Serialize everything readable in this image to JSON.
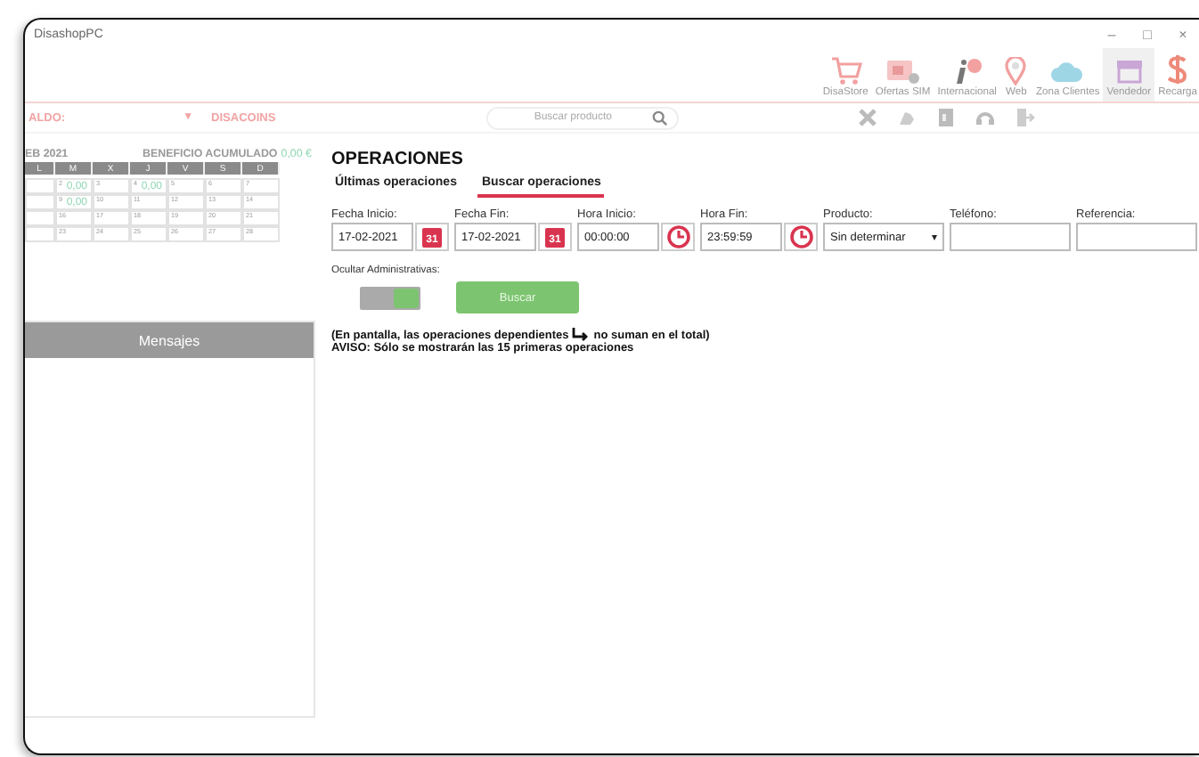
{
  "window": {
    "title": "DisashopPC",
    "controls": [
      "–",
      "□",
      "×"
    ]
  },
  "toolbar": [
    {
      "label": "DisaStore",
      "kind": "cart",
      "selected": false
    },
    {
      "label": "Ofertas SIM",
      "kind": "sim",
      "selected": false
    },
    {
      "label": "Internacional",
      "kind": "info",
      "selected": false
    },
    {
      "label": "Web",
      "kind": "pin",
      "selected": false
    },
    {
      "label": "Zona Clientes",
      "kind": "cloud",
      "selected": false
    },
    {
      "label": "Vendedor",
      "kind": "shop",
      "selected": true
    },
    {
      "label": "Recarga",
      "kind": "dollar",
      "selected": false
    }
  ],
  "balance_bar": {
    "balance_label": "ALDO:",
    "caret": "▼",
    "coins_label": "DISACOINS",
    "search": {
      "placeholder": "Buscar producto"
    }
  },
  "calendar": {
    "month": "EB 2021",
    "benefit_label": "BENEFICIO ACUMULADO",
    "benefit_value": "0,00 €",
    "weekdays": [
      "L",
      "M",
      "X",
      "J",
      "V",
      "S",
      "D"
    ],
    "weeks": [
      {
        "days": [
          {
            "day": "2",
            "amount": "0,00"
          },
          {
            "day": "3"
          },
          {
            "day": "4",
            "amount": "0,00"
          },
          {
            "day": "5"
          },
          {
            "day": "6"
          },
          {
            "day": "7"
          }
        ]
      },
      {
        "days": [
          {
            "day": "9",
            "amount": "0,00"
          },
          {
            "day": "10"
          },
          {
            "day": "11"
          },
          {
            "day": "12"
          },
          {
            "day": "13"
          },
          {
            "day": "14"
          }
        ]
      },
      {
        "days": [
          {
            "day": "16"
          },
          {
            "day": "17"
          },
          {
            "day": "18"
          },
          {
            "day": "19"
          },
          {
            "day": "20"
          },
          {
            "day": "21"
          }
        ]
      },
      {
        "days": [
          {
            "day": "23"
          },
          {
            "day": "24"
          },
          {
            "day": "25"
          },
          {
            "day": "26"
          },
          {
            "day": "27"
          },
          {
            "day": "28"
          }
        ]
      }
    ]
  },
  "messages": {
    "title": "Mensajes"
  },
  "operations": {
    "title": "OPERACIONES",
    "tabs": [
      {
        "label": "Últimas operaciones",
        "selected": false
      },
      {
        "label": "Buscar operaciones",
        "selected": true
      }
    ],
    "fields": [
      {
        "label": "Fecha Inicio:",
        "value": "17-02-2021",
        "kind": "date",
        "icon_text": "31"
      },
      {
        "label": "Fecha Fin:",
        "value": "17-02-2021",
        "kind": "date",
        "icon_text": "31"
      },
      {
        "label": "Hora Inicio:",
        "value": "00:00:00",
        "kind": "time"
      },
      {
        "label": "Hora Fin:",
        "value": "23:59:59",
        "kind": "time"
      },
      {
        "label": "Producto:",
        "value": "Sin determinar",
        "kind": "select",
        "caret": "▾"
      },
      {
        "label": "Teléfono:",
        "kind": "text"
      },
      {
        "label": "Referencia:",
        "kind": "text"
      }
    ],
    "hide_admin": {
      "label": "Ocultar Administrativas:",
      "on": true
    },
    "search_button": "Buscar",
    "note": {
      "before": "(En pantalla, las operaciones dependientes",
      "after": "no suman en el total)"
    },
    "warning": "AVISO: Sólo se mostrarán las 15 primeras operaciones"
  }
}
